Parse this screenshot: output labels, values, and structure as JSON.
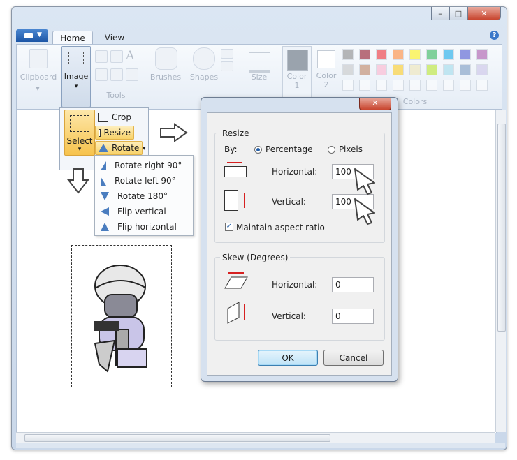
{
  "ribbon": {
    "tabs": [
      "Home",
      "View"
    ],
    "groups": {
      "clipboard": "Clipboard",
      "image": "Image",
      "tools": "Tools",
      "brushes": "Brushes",
      "shapes": "Shapes",
      "size": "Size",
      "color1": "Color\n1",
      "color2": "Color\n2",
      "colors": "Colors"
    }
  },
  "image_panel": {
    "select": "Select",
    "crop": "Crop",
    "resize": "Resize",
    "rotate": "Rotate"
  },
  "rotate_menu": {
    "items": [
      "Rotate right 90°",
      "Rotate left 90°",
      "Rotate 180°",
      "Flip vertical",
      "Flip horizontal"
    ]
  },
  "dialog": {
    "resize_group": "Resize",
    "by_label": "By:",
    "percentage": "Percentage",
    "pixels": "Pixels",
    "resize_horizontal_label": "Horizontal:",
    "resize_horizontal_value": "100",
    "resize_vertical_label": "Vertical:",
    "resize_vertical_value": "100",
    "maintain_aspect": "Maintain aspect ratio",
    "skew_group": "Skew (Degrees)",
    "skew_horizontal_label": "Horizontal:",
    "skew_horizontal_value": "0",
    "skew_vertical_label": "Vertical:",
    "skew_vertical_value": "0",
    "ok": "OK",
    "cancel": "Cancel",
    "percentage_selected": true,
    "maintain_aspect_checked": true
  },
  "colors": {
    "accent": "#1d56a6",
    "highlight": "#f8d268",
    "palette_row1": [
      "#7f7f7f",
      "#880015",
      "#ed1c24",
      "#ff7f27",
      "#fff200",
      "#22b14c",
      "#00a2e8",
      "#3f48cc",
      "#a349a4"
    ],
    "palette_row2": [
      "#c3c3c3",
      "#b97a57",
      "#ffaec9",
      "#ffc90e",
      "#efe4b0",
      "#b5e61d",
      "#99d9ea",
      "#7092be",
      "#c8bfe7"
    ]
  },
  "icons": [
    "app-menu-icon",
    "help-icon",
    "crop-icon",
    "resize-icon",
    "rotate-icon",
    "pointer-arrow-icon",
    "down-arrow-icon"
  ]
}
